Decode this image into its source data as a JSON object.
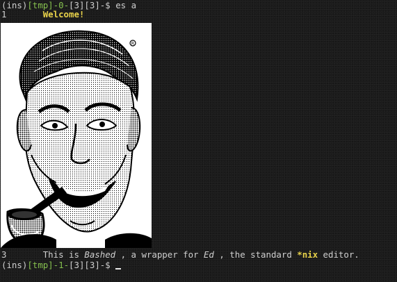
{
  "terminal": {
    "line1": {
      "prefix": "(ins)",
      "cwd": "[tmp]",
      "sep1": "-",
      "status": "0",
      "sep2": "-",
      "counts": "[3][3]",
      "dollar": "-$ ",
      "command": "es a"
    },
    "line2": {
      "line_no": "1",
      "gap": "       ",
      "text": "Welcome!"
    },
    "image": {
      "description_icon": "pipe-smoking-man-image",
      "registered_mark": "®"
    },
    "line3": {
      "line_no": "3",
      "gap": "       ",
      "t1": "This is ",
      "t2": "Bashed",
      "t3": " , a wrapper for ",
      "t4": "Ed",
      "t5": " , the standard ",
      "t6": "*nix",
      "t7": " editor."
    },
    "line4": {
      "prefix": "(ins)",
      "cwd": "[tmp]",
      "sep1": "-",
      "status": "1",
      "sep2": "-",
      "counts": "[3][3]",
      "dollar": "-$ "
    },
    "colors": {
      "background": "#1b1b1b",
      "text": "#c8c8c8",
      "green": "#86c14f",
      "yellow": "#e8d24a"
    }
  }
}
